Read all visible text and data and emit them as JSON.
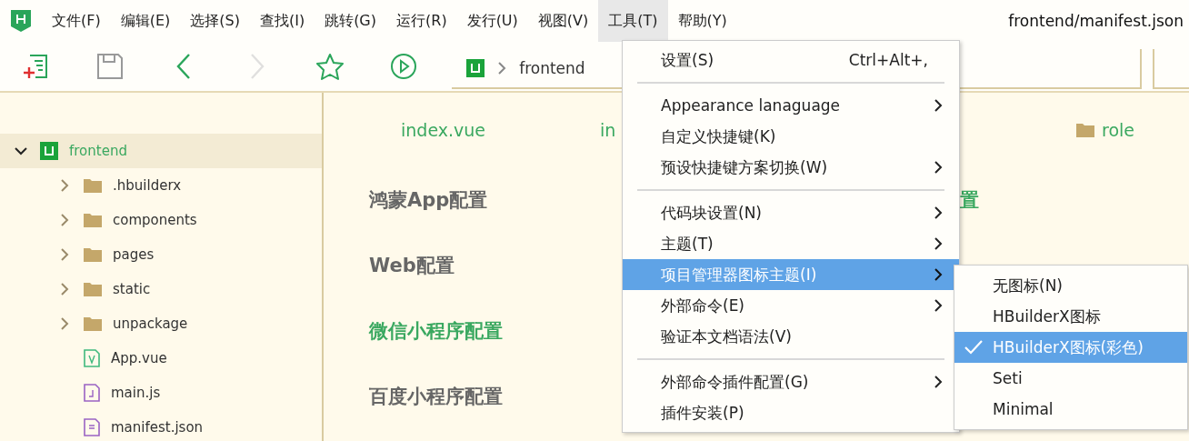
{
  "menubar": {
    "items": [
      {
        "label": "文件(F)",
        "selected": false
      },
      {
        "label": "编辑(E)",
        "selected": false
      },
      {
        "label": "选择(S)",
        "selected": false
      },
      {
        "label": "查找(I)",
        "selected": false
      },
      {
        "label": "跳转(G)",
        "selected": false
      },
      {
        "label": "运行(R)",
        "selected": false
      },
      {
        "label": "发行(U)",
        "selected": false
      },
      {
        "label": "视图(V)",
        "selected": false
      },
      {
        "label": "工具(T)",
        "selected": true
      },
      {
        "label": "帮助(Y)",
        "selected": false
      }
    ],
    "file_path": "frontend/manifest.json"
  },
  "toolbar": {
    "buttons": [
      {
        "kind": "new",
        "disabled": false
      },
      {
        "kind": "save",
        "disabled": false
      },
      {
        "kind": "back",
        "disabled": false
      },
      {
        "kind": "forward",
        "disabled": true
      },
      {
        "kind": "star",
        "disabled": false
      },
      {
        "kind": "run",
        "disabled": false
      }
    ],
    "breadcrumb": [
      "frontend"
    ]
  },
  "sidebar": {
    "tree": [
      {
        "label": "frontend",
        "kind": "project",
        "expanded": true,
        "selected": true,
        "children": [
          {
            "label": ".hbuilderx",
            "kind": "folder",
            "expanded": false,
            "selected": false
          },
          {
            "label": "components",
            "kind": "folder",
            "expanded": false,
            "selected": false
          },
          {
            "label": "pages",
            "kind": "folder",
            "expanded": false,
            "selected": false
          },
          {
            "label": "static",
            "kind": "folder",
            "expanded": false,
            "selected": false
          },
          {
            "label": "unpackage",
            "kind": "folder",
            "expanded": false,
            "selected": false
          },
          {
            "label": "App.vue",
            "kind": "vue",
            "selected": false
          },
          {
            "label": "main.js",
            "kind": "js",
            "selected": false
          },
          {
            "label": "manifest.json",
            "kind": "json",
            "selected": false
          }
        ]
      }
    ]
  },
  "editor": {
    "tabs": [
      {
        "label": "index.vue",
        "kind": "file"
      },
      {
        "label": "in",
        "kind": "file"
      },
      {
        "label": "role",
        "kind": "folder"
      }
    ],
    "sections": [
      {
        "label": "鸿蒙App配置",
        "selected": false
      },
      {
        "label": "Web配置",
        "selected": false
      },
      {
        "label": "微信小程序配置",
        "selected": true
      },
      {
        "label": "百度小程序配置",
        "selected": false
      }
    ],
    "side_sections": [
      {
        "label": "置",
        "selected": true
      }
    ]
  },
  "tools_menu": {
    "groups": [
      [
        {
          "label": "设置(S)",
          "shortcut": "Ctrl+Alt+,",
          "submenu": false,
          "selected": false
        }
      ],
      [
        {
          "label": "Appearance lanaguage",
          "submenu": true,
          "selected": false
        },
        {
          "label": "自定义快捷键(K)",
          "submenu": false,
          "selected": false
        },
        {
          "label": "预设快捷键方案切换(W)",
          "submenu": true,
          "selected": false
        }
      ],
      [
        {
          "label": "代码块设置(N)",
          "submenu": true,
          "selected": false
        },
        {
          "label": "主题(T)",
          "submenu": true,
          "selected": false
        },
        {
          "label": "项目管理器图标主题(I)",
          "submenu": true,
          "selected": true
        },
        {
          "label": "外部命令(E)",
          "submenu": true,
          "selected": false
        },
        {
          "label": "验证本文档语法(V)",
          "submenu": false,
          "selected": false
        }
      ],
      [
        {
          "label": "外部命令插件配置(G)",
          "submenu": true,
          "selected": false
        },
        {
          "label": "插件安装(P)",
          "submenu": false,
          "selected": false
        }
      ]
    ]
  },
  "icon_theme_submenu": {
    "items": [
      {
        "label": "无图标(N)",
        "checked": false
      },
      {
        "label": "HBuilderX图标",
        "checked": false
      },
      {
        "label": "HBuilderX图标(彩色)",
        "checked": true
      },
      {
        "label": "Seti",
        "checked": false
      },
      {
        "label": "Minimal",
        "checked": false
      }
    ]
  }
}
